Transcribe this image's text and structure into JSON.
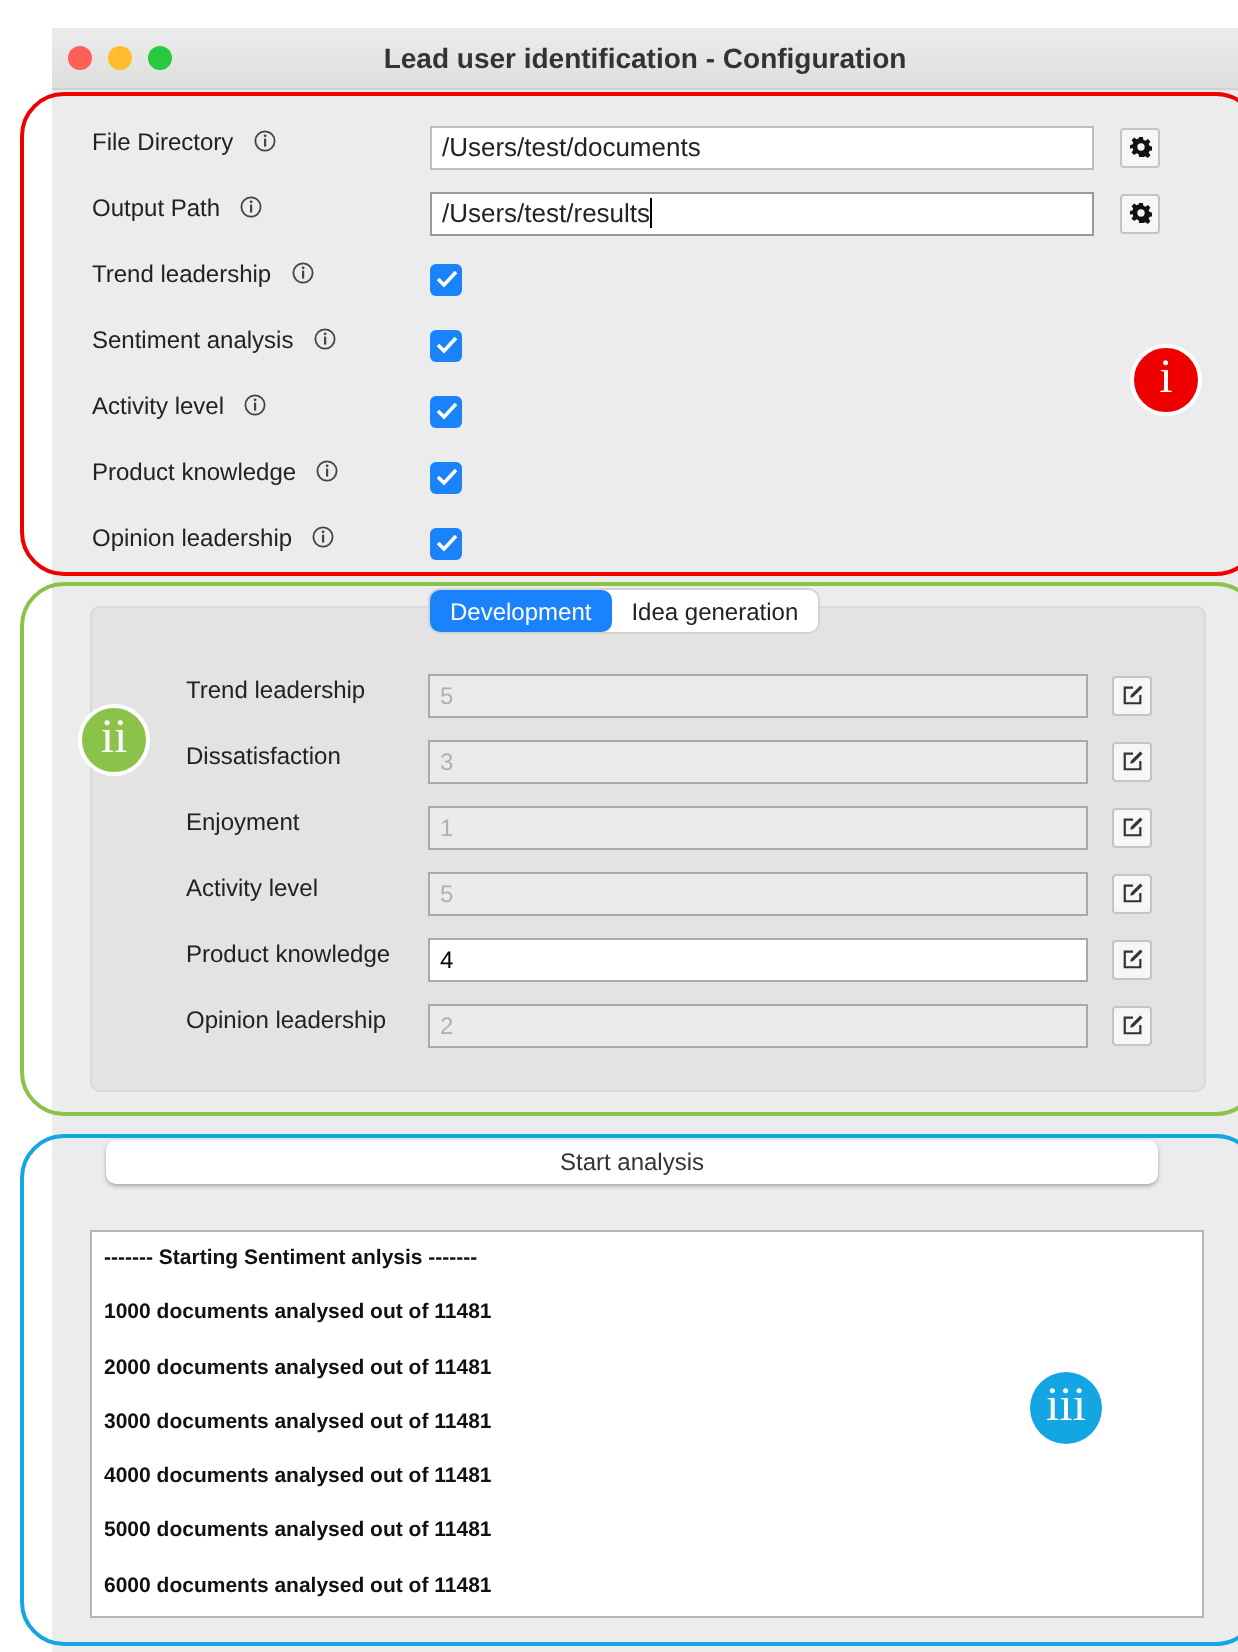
{
  "window": {
    "title": "Lead user identification - Configuration"
  },
  "settings": {
    "callout": {
      "label": "i",
      "color": "#ee0000"
    },
    "rows": [
      {
        "kind": "path",
        "label": "File Directory",
        "value": "/Users/test/documents",
        "focused": false
      },
      {
        "kind": "path",
        "label": "Output Path",
        "value": "/Users/test/results",
        "focused": true
      },
      {
        "kind": "checkbox",
        "label": "Trend leadership",
        "checked": true
      },
      {
        "kind": "checkbox",
        "label": "Sentiment analysis",
        "checked": true
      },
      {
        "kind": "checkbox",
        "label": "Activity level",
        "checked": true
      },
      {
        "kind": "checkbox",
        "label": "Product knowledge",
        "checked": true
      },
      {
        "kind": "checkbox",
        "label": "Opinion leadership",
        "checked": true
      }
    ]
  },
  "weights": {
    "callout": {
      "label": "ii",
      "color": "#8bc34a"
    },
    "tabs": [
      {
        "label": "Development",
        "selected": true
      },
      {
        "label": "Idea generation",
        "selected": false
      }
    ],
    "rows": [
      {
        "label": "Trend leadership",
        "value": "5",
        "enabled": false
      },
      {
        "label": "Dissatisfaction",
        "value": "3",
        "enabled": false
      },
      {
        "label": "Enjoyment",
        "value": "1",
        "enabled": false
      },
      {
        "label": "Activity level",
        "value": "5",
        "enabled": false
      },
      {
        "label": "Product knowledge",
        "value": "4",
        "enabled": true
      },
      {
        "label": "Opinion leadership",
        "value": "2",
        "enabled": false
      }
    ]
  },
  "output": {
    "callout": {
      "label": "iii",
      "color": "#14a5e3"
    },
    "button": "Start analysis",
    "log": [
      "------- Starting Sentiment anlysis -------",
      "1000 documents analysed out of 11481",
      "2000 documents analysed out of 11481",
      "3000 documents analysed out of 11481",
      "4000 documents analysed out of 11481",
      "5000 documents analysed out of 11481",
      "6000 documents analysed out of 11481"
    ]
  }
}
